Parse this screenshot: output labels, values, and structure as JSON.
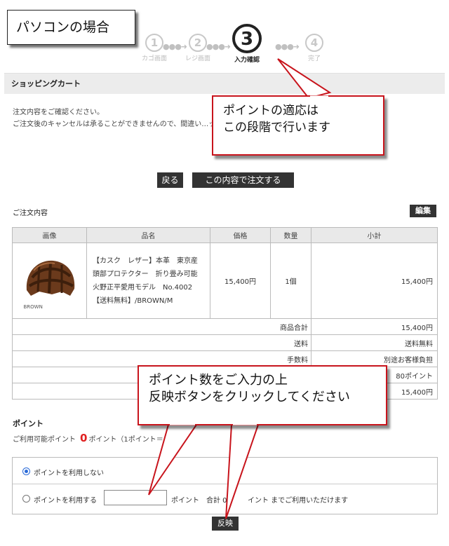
{
  "title_box": "パソコンの場合",
  "steps": [
    {
      "num": "1",
      "label": "カゴ画面"
    },
    {
      "num": "2",
      "label": "レジ画面"
    },
    {
      "num": "3",
      "label": "入力確認"
    },
    {
      "num": "4",
      "label": "完了"
    }
  ],
  "cart_header": "ショッピングカート",
  "message": "注文内容をご確認ください。\nご注文後のキャンセルは承ることができませんので、間違い…ックしてください。",
  "buttons": {
    "back": "戻る",
    "order": "この内容で注文する",
    "edit": "編集",
    "apply": "反映"
  },
  "order_section_label": "ご注文内容",
  "table": {
    "headers": [
      "画像",
      "品名",
      "価格",
      "数量",
      "小計"
    ],
    "product": {
      "image_label": "BROWN",
      "name": "【カスク　レザー】本革　東京産　頭部プロテクター　折り畳み可能　火野正平愛用モデル　No.4002 【送料無料】/BROWN/M",
      "price": "15,400円",
      "qty": "1個",
      "subtotal": "15,400円"
    },
    "summary": [
      {
        "label": "商品合計",
        "value": "15,400円"
      },
      {
        "label": "送料",
        "value": "送料無料"
      },
      {
        "label": "手数料",
        "value": "別途お客様負担"
      },
      {
        "label": "",
        "value": "80ポイント"
      },
      {
        "label": "",
        "value": "15,400円"
      }
    ]
  },
  "points": {
    "title": "ポイント",
    "available_prefix": "ご利用可能ポイント",
    "available_value": "0",
    "available_suffix": "ポイント（1ポイント＝",
    "option_no": "ポイントを利用しない",
    "option_yes": "ポイントを利用する",
    "after_input": "ポイント　合計 0",
    "after_input2": "イント までご利用いただけます"
  },
  "callouts": {
    "step_note": "ポイントの適応は\nこの段階で行います",
    "input_note": "ポイント数をご入力の上\n反映ボタンをクリックしてください"
  },
  "colors": {
    "accent_red": "#e02020",
    "callout_border": "#c8141c",
    "dark_button": "#333333"
  }
}
